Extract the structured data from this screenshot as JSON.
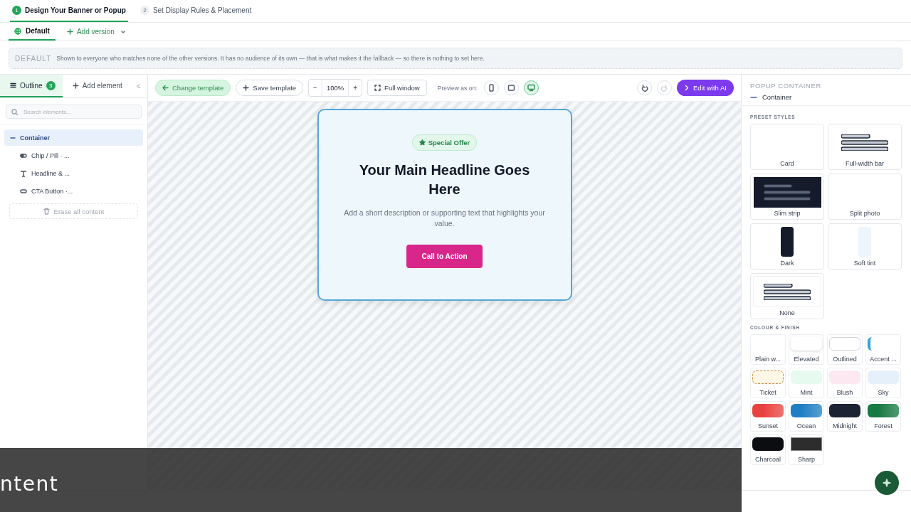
{
  "steps": [
    {
      "number": "1",
      "label": "Design Your Banner or Popup",
      "selected": true
    },
    {
      "number": "2",
      "label": "Set Display Rules & Placement",
      "selected": false
    }
  ],
  "versions": {
    "tabs": [
      {
        "label": "Default",
        "selected": true
      }
    ],
    "add_label": "Add version"
  },
  "info": {
    "tag": "DEFAULT",
    "text": "Shown to everyone who matches none of the other versions. It has no audience of its own — that is what makes it the fallback — so there is nothing to set here."
  },
  "left_panel": {
    "tabs": [
      {
        "label": "Outline",
        "badge": "3",
        "selected": true
      },
      {
        "label": "Add element",
        "selected": false
      }
    ],
    "collapse": "<",
    "search": {
      "placeholder": "Search elements..."
    },
    "tree": [
      {
        "label": "Container",
        "expanded": true,
        "selected": true,
        "children": [
          {
            "label": "Chip / Pill · ...",
            "kind": "chip",
            "selected": false
          },
          {
            "label": "Headline & ...",
            "kind": "text",
            "selected": false
          },
          {
            "label": "CTA Button ·...",
            "kind": "button",
            "selected": false
          }
        ]
      }
    ],
    "erase": "Erase all content"
  },
  "toolbar": {
    "change_template": "Change template",
    "save_template": "Save template",
    "zoom_out": "−",
    "zoom": "100%",
    "zoom_in": "+",
    "full_window": "Full window",
    "preview_label": "Preview as on:",
    "devices": [
      {
        "kind": "mobile",
        "selected": false
      },
      {
        "kind": "tablet",
        "selected": false
      },
      {
        "kind": "desktop",
        "selected": true
      }
    ],
    "undo": {
      "disabled": false
    },
    "redo": {
      "disabled": true
    },
    "edit_ai": "Edit with AI"
  },
  "popup": {
    "chip": "Special Offer",
    "headline": "Your Main Headline Goes Here",
    "description": "Add a short description or supporting text that highlights your value.",
    "cta": "Call to Action"
  },
  "right_panel": {
    "title": "POPUP CONTAINER",
    "element": "Container",
    "preset_heading": "PRESET STYLES",
    "presets": [
      {
        "label": "Card",
        "kind": "blank"
      },
      {
        "label": "Full-width bar",
        "kind": "bars"
      },
      {
        "label": "Slim strip",
        "kind": "strip"
      },
      {
        "label": "Split photo",
        "kind": "blank"
      },
      {
        "label": "Dark",
        "kind": "dark"
      },
      {
        "label": "Soft tint",
        "kind": "tint"
      },
      {
        "label": "None",
        "kind": "none"
      }
    ],
    "finish_heading": "COLOUR & FINISH",
    "finishes": [
      {
        "label": "Plain w...",
        "kind": "plain"
      },
      {
        "label": "Elevated",
        "kind": "elevated"
      },
      {
        "label": "Outlined",
        "kind": "outlined"
      },
      {
        "label": "Accent ...",
        "kind": "accent",
        "color": "#2aa3d8"
      },
      {
        "label": "Ticket",
        "kind": "ticket",
        "color": "#fff7e6"
      },
      {
        "label": "Mint",
        "kind": "solid",
        "color": "#e6faef"
      },
      {
        "label": "Blush",
        "kind": "solid",
        "color": "#fbe8f0"
      },
      {
        "label": "Sky",
        "kind": "solid",
        "color": "#e6f0fb"
      },
      {
        "label": "Sunset",
        "kind": "gradient",
        "color": "#e8413f"
      },
      {
        "label": "Ocean",
        "kind": "gradient",
        "color": "#1f7fc4"
      },
      {
        "label": "Midnight",
        "kind": "solid",
        "color": "#1c2433"
      },
      {
        "label": "Forest",
        "kind": "gradient",
        "color": "#167a44"
      },
      {
        "label": "Charcoal",
        "kind": "solid",
        "color": "#0b0d10"
      },
      {
        "label": "Sharp",
        "kind": "sharp",
        "color": "#2d2d2d"
      }
    ]
  },
  "caption": "ntent"
}
